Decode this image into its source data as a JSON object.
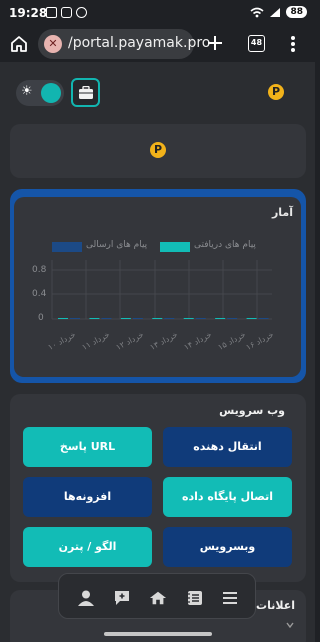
{
  "status_bar": {
    "time": "19:28",
    "battery": "88"
  },
  "browser": {
    "url": "/portal.payamak.pro",
    "tab_count": "48"
  },
  "stats": {
    "title": "آمار",
    "legend": {
      "received": "پیام های دریافتی",
      "sent": "پیام های ارسالی"
    },
    "colors": {
      "received": "#12bcb6",
      "sent": "#1c4a86"
    },
    "yticks": [
      "0.8",
      "0.4",
      "0"
    ],
    "xticks": [
      "۱۰ خرداد",
      "۱۱ خرداد",
      "۱۲ خرداد",
      "۱۳ خرداد",
      "۱۴ خرداد",
      "۱۵ خرداد",
      "۱۶ خرداد"
    ]
  },
  "chart_data": {
    "type": "bar",
    "title": "آمار",
    "categories": [
      "۱۰ خرداد",
      "۱۱ خرداد",
      "۱۲ خرداد",
      "۱۳ خرداد",
      "۱۴ خرداد",
      "۱۵ خرداد",
      "۱۶ خرداد"
    ],
    "series": [
      {
        "name": "پیام های دریافتی",
        "values": [
          0,
          0,
          0,
          0,
          0,
          0,
          0
        ]
      },
      {
        "name": "پیام های ارسالی",
        "values": [
          0,
          0,
          0,
          0,
          0,
          0,
          0
        ]
      }
    ],
    "ylim": [
      0,
      1
    ],
    "grid": true,
    "legend": "top"
  },
  "web_service": {
    "title": "وب سرویس",
    "buttons": {
      "transfer": "انتقال دهنده",
      "url_reply": "پاسخ URL",
      "db_connect": "اتصال پایگاه داده",
      "addons": "افزونه‌ها",
      "webservice": "وبسرویس",
      "pattern": "الگو / پترن"
    }
  },
  "notifications": {
    "title": "اعلانات"
  },
  "logo_letter": "P"
}
